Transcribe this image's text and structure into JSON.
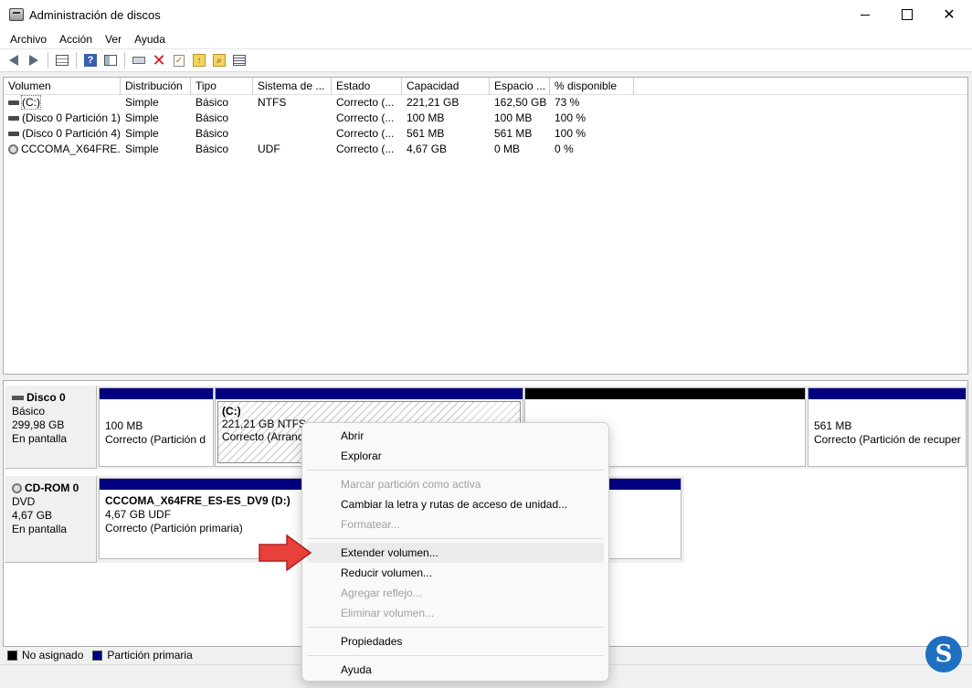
{
  "window": {
    "title": "Administración de discos"
  },
  "menubar": {
    "items": [
      "Archivo",
      "Acción",
      "Ver",
      "Ayuda"
    ]
  },
  "toolbar": {
    "help_glyph": "?"
  },
  "volume_list": {
    "headers": [
      "Volumen",
      "Distribución",
      "Tipo",
      "Sistema de ...",
      "Estado",
      "Capacidad",
      "Espacio ...",
      "% disponible"
    ],
    "rows": [
      {
        "volume": "(C:)",
        "layout": "Simple",
        "type": "Básico",
        "fs": "NTFS",
        "status": "Correcto (...",
        "capacity": "221,21 GB",
        "free": "162,50 GB",
        "pct": "73 %",
        "icon": "drive-icon"
      },
      {
        "volume": "(Disco 0 Partición 1)",
        "layout": "Simple",
        "type": "Básico",
        "fs": "",
        "status": "Correcto (...",
        "capacity": "100 MB",
        "free": "100 MB",
        "pct": "100 %",
        "icon": "drive-icon"
      },
      {
        "volume": "(Disco 0 Partición 4)",
        "layout": "Simple",
        "type": "Básico",
        "fs": "",
        "status": "Correcto (...",
        "capacity": "561 MB",
        "free": "561 MB",
        "pct": "100 %",
        "icon": "drive-icon"
      },
      {
        "volume": "CCCOMA_X64FRE...",
        "layout": "Simple",
        "type": "Básico",
        "fs": "UDF",
        "status": "Correcto (...",
        "capacity": "4,67 GB",
        "free": "0 MB",
        "pct": "0 %",
        "icon": "cd-icon"
      }
    ]
  },
  "disks": {
    "disk0": {
      "title": "Disco 0",
      "kind": "Básico",
      "size": "299,98 GB",
      "state": "En pantalla",
      "p1": {
        "size": "100 MB",
        "status": "Correcto (Partición d"
      },
      "p2": {
        "name": "(C:)",
        "size": "221,21 GB NTFS",
        "status": "Correcto (Arranc"
      },
      "p4": {
        "size": "561 MB",
        "status": "Correcto (Partición de recuper"
      }
    },
    "cdrom0": {
      "title": "CD-ROM 0",
      "kind": "DVD",
      "size": "4,67 GB",
      "state": "En pantalla",
      "p1": {
        "name": "CCCOMA_X64FRE_ES-ES_DV9  (D:)",
        "size": "4,67 GB UDF",
        "status": "Correcto (Partición primaria)"
      }
    }
  },
  "legend": {
    "unallocated": "No asignado",
    "primary": "Partición primaria",
    "unallocated_color": "#000000",
    "primary_color": "#000080"
  },
  "context_menu": {
    "open": "Abrir",
    "explore": "Explorar",
    "mark_active": "Marcar partición como activa",
    "change_letter": "Cambiar la letra y rutas de acceso de unidad...",
    "format": "Formatear...",
    "extend": "Extender volumen...",
    "shrink": "Reducir volumen...",
    "add_mirror": "Agregar reflejo...",
    "delete": "Eliminar volumen...",
    "properties": "Propiedades",
    "help": "Ayuda"
  },
  "logo": {
    "glyph": "S"
  }
}
